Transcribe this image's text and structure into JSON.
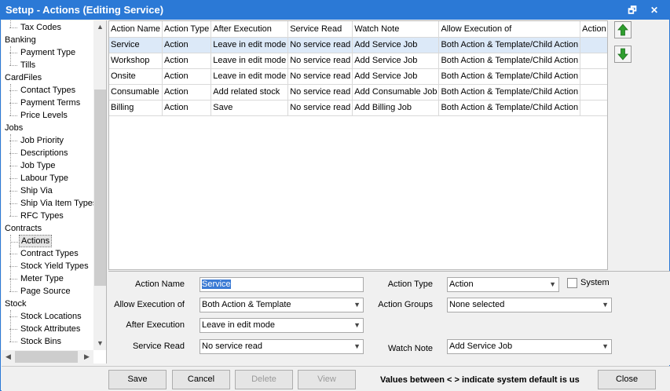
{
  "window": {
    "title": "Setup - Actions (Editing Service)",
    "restore_glyph": "🗗",
    "close_glyph": "✕"
  },
  "tree": {
    "items": [
      {
        "label": "Tax Codes",
        "level": 1
      },
      {
        "label": "Banking",
        "level": 0
      },
      {
        "label": "Payment Type",
        "level": 1
      },
      {
        "label": "Tills",
        "level": 1
      },
      {
        "label": "CardFiles",
        "level": 0
      },
      {
        "label": "Contact Types",
        "level": 1
      },
      {
        "label": "Payment Terms",
        "level": 1
      },
      {
        "label": "Price Levels",
        "level": 1
      },
      {
        "label": "Jobs",
        "level": 0
      },
      {
        "label": "Job Priority",
        "level": 1
      },
      {
        "label": "Descriptions",
        "level": 1
      },
      {
        "label": "Job Type",
        "level": 1
      },
      {
        "label": "Labour Type",
        "level": 1
      },
      {
        "label": "Ship Via",
        "level": 1
      },
      {
        "label": "Ship Via Item Types",
        "level": 1
      },
      {
        "label": "RFC Types",
        "level": 1
      },
      {
        "label": "Contracts",
        "level": 0
      },
      {
        "label": "Actions",
        "level": 1,
        "selected": true
      },
      {
        "label": "Contract Types",
        "level": 1
      },
      {
        "label": "Stock Yield Types",
        "level": 1
      },
      {
        "label": "Meter Type",
        "level": 1
      },
      {
        "label": "Page Source",
        "level": 1
      },
      {
        "label": "Stock",
        "level": 0
      },
      {
        "label": "Stock Locations",
        "level": 1
      },
      {
        "label": "Stock Attributes",
        "level": 1
      },
      {
        "label": "Stock Bins",
        "level": 1
      }
    ]
  },
  "grid": {
    "columns": [
      "Action Name",
      "Action Type",
      "After Execution",
      "Service Read",
      "Watch Note",
      "Allow Execution of",
      "Action G"
    ],
    "rows": [
      [
        "Service",
        "Action",
        "Leave in edit mode",
        "No service read",
        "Add Service Job",
        "Both Action & Template/Child Action",
        ""
      ],
      [
        "Workshop",
        "Action",
        "Leave in edit mode",
        "No service read",
        "Add Service Job",
        "Both Action & Template/Child Action",
        ""
      ],
      [
        "Onsite",
        "Action",
        "Leave in edit mode",
        "No service read",
        "Add Service Job",
        "Both Action & Template/Child Action",
        ""
      ],
      [
        "Consumable",
        "Action",
        "Add related stock",
        "No service read",
        "Add Consumable Job",
        "Both Action & Template/Child Action",
        ""
      ],
      [
        "Billing",
        "Action",
        "Save",
        "No service read",
        "Add Billing Job",
        "Both Action & Template/Child Action",
        ""
      ]
    ],
    "selected_row": 0
  },
  "form": {
    "action_name_label": "Action Name",
    "action_name_value": "Service",
    "allow_exec_label": "Allow Execution of",
    "allow_exec_value": "Both Action & Template",
    "after_exec_label": "After Execution",
    "after_exec_value": "Leave in edit mode",
    "service_read_label": "Service Read",
    "service_read_value": "No service read",
    "action_type_label": "Action Type",
    "action_type_value": "Action",
    "system_label": "System",
    "action_groups_label": "Action Groups",
    "action_groups_value": "None selected",
    "watch_note_label": "Watch Note",
    "watch_note_value": "Add Service Job"
  },
  "buttons": {
    "save": "Save",
    "cancel": "Cancel",
    "delete": "Delete",
    "view": "View",
    "close": "Close"
  },
  "note": "Values between < > indicate system default is us",
  "colors": {
    "titlebar": "#2b79d6",
    "selection": "#dce9f8",
    "arrow_green": "#2e9e2e"
  }
}
